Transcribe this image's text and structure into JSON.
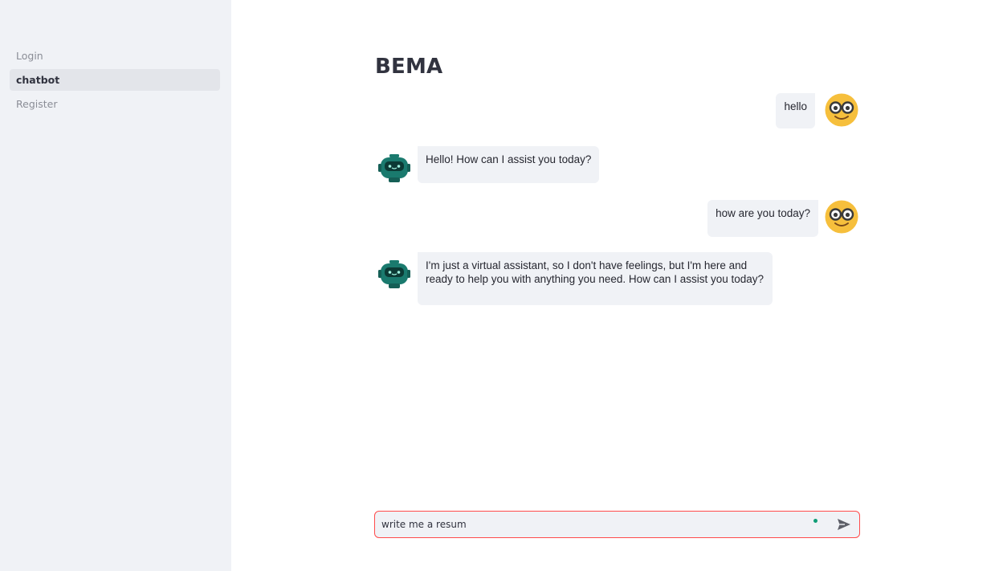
{
  "sidebar": {
    "items": [
      {
        "label": "Login",
        "active": false
      },
      {
        "label": "chatbot",
        "active": true
      },
      {
        "label": "Register",
        "active": false
      }
    ]
  },
  "main": {
    "title": "BEMA",
    "messages": [
      {
        "role": "user",
        "text": "hello",
        "avatar": "nerd-face-icon"
      },
      {
        "role": "assistant",
        "text": "Hello! How can I assist you today?",
        "avatar": "robot-icon"
      },
      {
        "role": "user",
        "text": "how are you today?",
        "avatar": "nerd-face-icon"
      },
      {
        "role": "assistant",
        "text": "I'm just a virtual assistant, so I don't have feelings, but I'm here and ready to help you with anything you need. How can I assist you today?",
        "avatar": "robot-icon"
      }
    ],
    "chat_input": {
      "value": "write me a resum",
      "send_icon": "send-icon"
    }
  },
  "colors": {
    "sidebar_bg": "#f0f2f6",
    "accent": "#ff4b4b",
    "bot_avatar": "#1a7a6e",
    "user_avatar": "#f6bf3c"
  }
}
